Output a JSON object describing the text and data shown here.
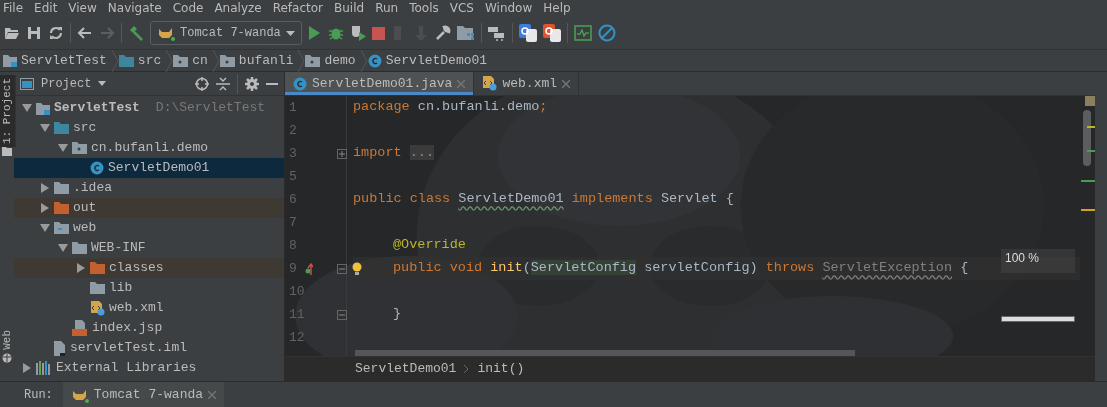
{
  "menu": [
    {
      "label": "File"
    },
    {
      "label": "Edit"
    },
    {
      "label": "View"
    },
    {
      "label": "Navigate"
    },
    {
      "label": "Code"
    },
    {
      "label": "Analyze"
    },
    {
      "label": "Refactor"
    },
    {
      "label": "Build"
    },
    {
      "label": "Run"
    },
    {
      "label": "Tools"
    },
    {
      "label": "VCS"
    },
    {
      "label": "Window"
    },
    {
      "label": "Help"
    }
  ],
  "toolbar": {
    "run_configuration": "Tomcat 7-wanda"
  },
  "breadcrumbs": [
    {
      "label": "ServletTest",
      "kind": "project"
    },
    {
      "label": "src",
      "kind": "source"
    },
    {
      "label": "cn",
      "kind": "package"
    },
    {
      "label": "bufanli",
      "kind": "package"
    },
    {
      "label": "demo",
      "kind": "package"
    },
    {
      "label": "ServletDemo01",
      "kind": "class"
    }
  ],
  "left_strip": [
    {
      "label": "1: Project",
      "selected": true
    },
    {
      "label": "Web",
      "selected": false
    }
  ],
  "project_panel": {
    "title": "Project",
    "tree": [
      {
        "label": "ServletTest",
        "note": "D:\\ServletTest",
        "kind": "project",
        "expanded": true,
        "selected": false,
        "children": [
          {
            "label": "src",
            "kind": "source",
            "expanded": true,
            "selected": false,
            "children": [
              {
                "label": "cn.bufanli.demo",
                "kind": "package",
                "expanded": true,
                "selected": false,
                "children": [
                  {
                    "label": "ServletDemo01",
                    "kind": "class",
                    "selected": true
                  }
                ]
              }
            ]
          },
          {
            "label": ".idea",
            "kind": "folder",
            "expanded": false,
            "selected": false
          },
          {
            "label": "out",
            "kind": "excluded",
            "expanded": false,
            "selected": false
          },
          {
            "label": "web",
            "kind": "web",
            "expanded": true,
            "selected": false,
            "children": [
              {
                "label": "WEB-INF",
                "kind": "folder",
                "expanded": true,
                "selected": false,
                "children": [
                  {
                    "label": "classes",
                    "kind": "excluded",
                    "expanded": false,
                    "selected": false
                  },
                  {
                    "label": "lib",
                    "kind": "folder",
                    "selected": false
                  },
                  {
                    "label": "web.xml",
                    "kind": "xml",
                    "selected": false
                  }
                ]
              },
              {
                "label": "index.jsp",
                "kind": "jsp",
                "selected": false
              }
            ]
          },
          {
            "label": "servletTest.iml",
            "kind": "file",
            "selected": false
          }
        ]
      },
      {
        "label": "External Libraries",
        "kind": "libraries",
        "expanded": false,
        "selected": false
      }
    ]
  },
  "editor": {
    "tabs": [
      {
        "label": "ServletDemo01.java",
        "kind": "class",
        "selected": true
      },
      {
        "label": "web.xml",
        "kind": "xml",
        "selected": false
      }
    ],
    "lines": [
      {
        "number": "1",
        "tokens": [
          {
            "text": "package",
            "kind": "keyword"
          },
          {
            "text": " cn.bufanli.demo",
            "kind": "plain"
          },
          {
            "text": ";",
            "kind": "keyword"
          }
        ]
      },
      {
        "number": "2"
      },
      {
        "number": "3",
        "collapsed": true,
        "tokens": [
          {
            "text": "import ",
            "kind": "keyword"
          },
          {
            "text": "...",
            "kind": "folded"
          }
        ]
      },
      {
        "number": "5"
      },
      {
        "number": "6",
        "tokens": [
          {
            "text": "public class ",
            "kind": "keyword"
          },
          {
            "text": "ServletDemo01",
            "kind": "typo"
          },
          {
            "text": " implements ",
            "kind": "keyword"
          },
          {
            "text": "Servlet {",
            "kind": "plain"
          }
        ]
      },
      {
        "number": "7"
      },
      {
        "number": "8",
        "indented": true,
        "tokens": [
          {
            "text": "@Override",
            "kind": "annotation"
          }
        ]
      },
      {
        "number": "9",
        "collapsed": false,
        "indented": true,
        "bulb": true,
        "override": true,
        "tokens": [
          {
            "text": "public void ",
            "kind": "keyword"
          },
          {
            "text": "init",
            "kind": "method"
          },
          {
            "text": "(",
            "kind": "plain"
          },
          {
            "text": "ServletConfig",
            "kind": "highlight"
          },
          {
            "text": " servletConfig) ",
            "kind": "plain"
          },
          {
            "text": "throws ",
            "kind": "keyword"
          },
          {
            "text": "ServletException",
            "kind": "unused"
          },
          {
            "text": " {",
            "kind": "plain"
          }
        ]
      },
      {
        "number": "10"
      },
      {
        "number": "11",
        "collapsed": false,
        "indented": true,
        "tokens": [
          {
            "text": "}",
            "kind": "plain"
          }
        ]
      },
      {
        "number": "12"
      }
    ],
    "zoom": "100 %",
    "footer_breadcrumbs": [
      "ServletDemo01",
      "init()"
    ]
  },
  "run_bar": {
    "label": "Run:",
    "tab": "Tomcat 7-wanda"
  }
}
